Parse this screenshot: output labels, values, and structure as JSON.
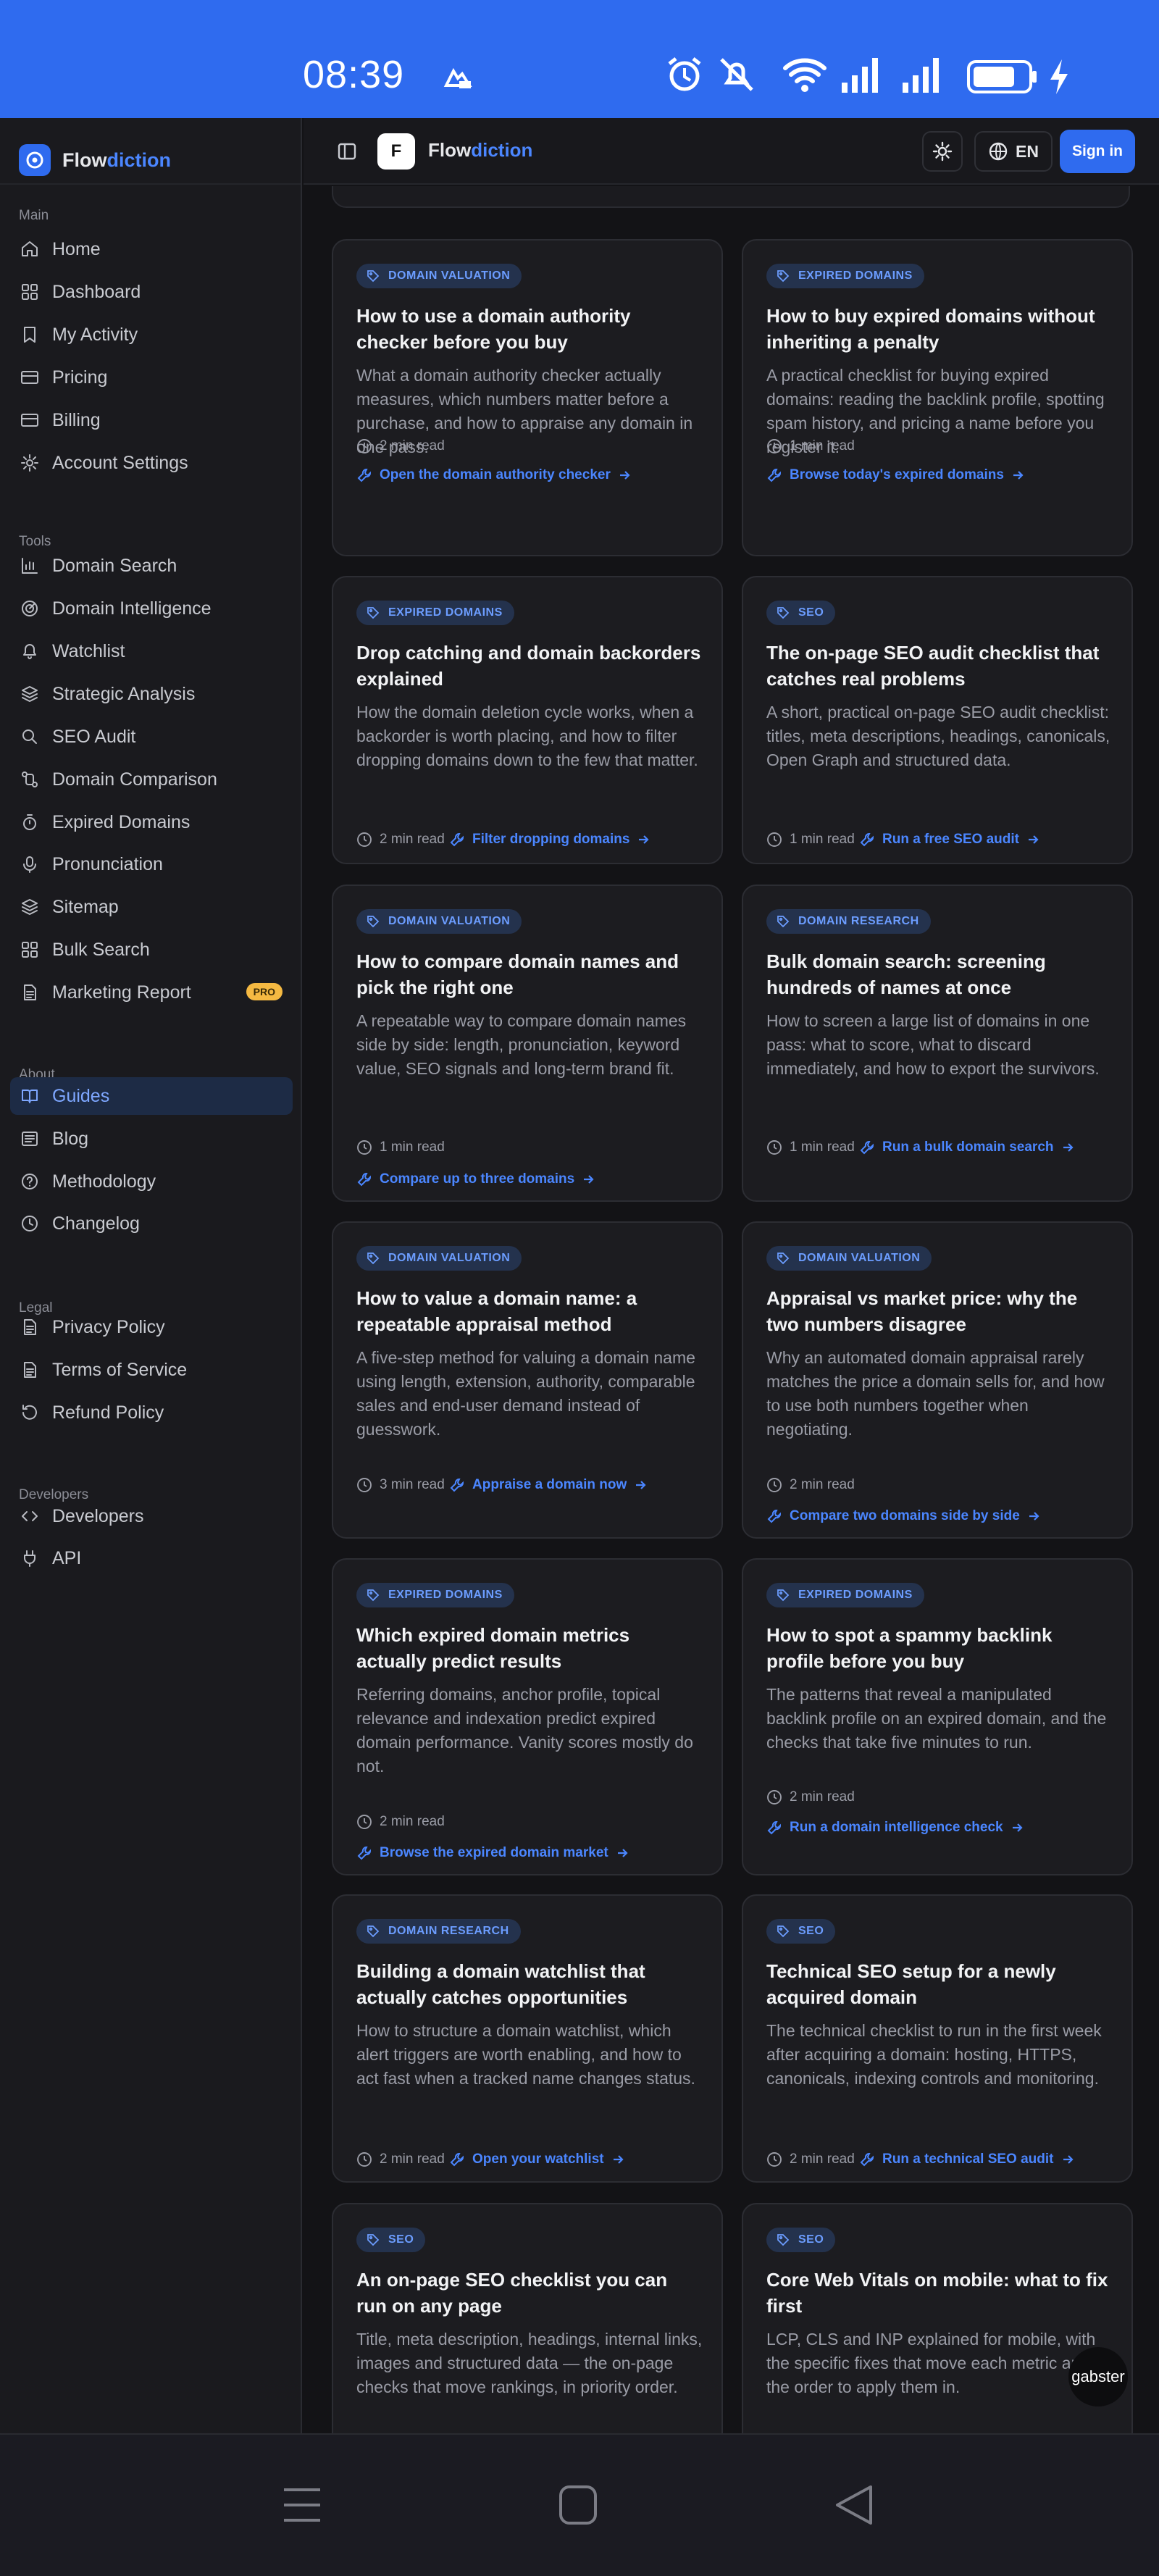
{
  "status_bar": {
    "time": "08:39"
  },
  "brand": {
    "name_part1": "Flow",
    "name_part2": "diction"
  },
  "sidebar": {
    "sections": [
      {
        "title": "Main",
        "items": [
          {
            "label": "Home",
            "icon": "home-icon"
          },
          {
            "label": "Dashboard",
            "icon": "grid-icon"
          },
          {
            "label": "My Activity",
            "icon": "bookmark-icon"
          },
          {
            "label": "Pricing",
            "icon": "card-icon"
          },
          {
            "label": "Billing",
            "icon": "card-icon"
          },
          {
            "label": "Account Settings",
            "icon": "gear-icon"
          }
        ]
      },
      {
        "title": "Tools",
        "items": [
          {
            "label": "Domain Search",
            "icon": "chart-icon"
          },
          {
            "label": "Domain Intelligence",
            "icon": "radar-icon"
          },
          {
            "label": "Watchlist",
            "icon": "bell-icon"
          },
          {
            "label": "Strategic Analysis",
            "icon": "layers-icon"
          },
          {
            "label": "SEO Audit",
            "icon": "search-icon"
          },
          {
            "label": "Domain Comparison",
            "icon": "compare-icon"
          },
          {
            "label": "Expired Domains",
            "icon": "timer-icon"
          },
          {
            "label": "Pronunciation",
            "icon": "mic-icon"
          },
          {
            "label": "Sitemap",
            "icon": "layers-icon"
          },
          {
            "label": "Bulk Search",
            "icon": "grid-icon"
          },
          {
            "label": "Marketing Report",
            "icon": "document-icon",
            "badge": "PRO"
          }
        ]
      },
      {
        "title": "About",
        "items": [
          {
            "label": "Guides",
            "icon": "book-icon",
            "active": true
          },
          {
            "label": "Blog",
            "icon": "newspaper-icon"
          },
          {
            "label": "Methodology",
            "icon": "help-icon"
          },
          {
            "label": "Changelog",
            "icon": "clock-icon"
          }
        ]
      },
      {
        "title": "Legal",
        "items": [
          {
            "label": "Privacy Policy",
            "icon": "document-icon"
          },
          {
            "label": "Terms of Service",
            "icon": "document-icon"
          },
          {
            "label": "Refund Policy",
            "icon": "refund-icon"
          }
        ]
      },
      {
        "title": "Developers",
        "items": [
          {
            "label": "Developers",
            "icon": "code-icon"
          },
          {
            "label": "API",
            "icon": "plug-icon"
          }
        ]
      }
    ]
  },
  "header": {
    "avatar_letter": "F",
    "title_part1": "Flow",
    "title_part2": "diction",
    "lang": "EN",
    "signin": "Sign in"
  },
  "guides": [
    {
      "tag": "DOMAIN VALUATION",
      "title": "How to use a domain authority checker before you buy",
      "desc": "What a domain authority checker actually measures, which numbers matter before a purchase, and how to appraise any domain in one pass.",
      "read": "2 min read",
      "link": "Open the domain authority checker"
    },
    {
      "tag": "EXPIRED DOMAINS",
      "title": "How to buy expired domains without inheriting a penalty",
      "desc": "A practical checklist for buying expired domains: reading the backlink profile, spotting spam history, and pricing a name before you register it.",
      "read": "1 min read",
      "link": "Browse today's expired domains"
    },
    {
      "tag": "EXPIRED DOMAINS",
      "title": "Drop catching and domain backorders explained",
      "desc": "How the domain deletion cycle works, when a backorder is worth placing, and how to filter dropping domains down to the few that matter.",
      "read": "2 min read",
      "link": "Filter dropping domains"
    },
    {
      "tag": "SEO",
      "title": "The on-page SEO audit checklist that catches real problems",
      "desc": "A short, practical on-page SEO audit checklist: titles, meta descriptions, headings, canonicals, Open Graph and structured data.",
      "read": "1 min read",
      "link": "Run a free SEO audit"
    },
    {
      "tag": "DOMAIN VALUATION",
      "title": "How to compare domain names and pick the right one",
      "desc": "A repeatable way to compare domain names side by side: length, pronunciation, keyword value, SEO signals and long-term brand fit.",
      "read": "1 min read",
      "link": "Compare up to three domains"
    },
    {
      "tag": "DOMAIN RESEARCH",
      "title": "Bulk domain search: screening hundreds of names at once",
      "desc": "How to screen a large list of domains in one pass: what to score, what to discard immediately, and how to export the survivors.",
      "read": "1 min read",
      "link": "Run a bulk domain search"
    },
    {
      "tag": "DOMAIN VALUATION",
      "title": "How to value a domain name: a repeatable appraisal method",
      "desc": "A five-step method for valuing a domain name using length, extension, authority, comparable sales and end-user demand instead of guesswork.",
      "read": "3 min read",
      "link": "Appraise a domain now"
    },
    {
      "tag": "DOMAIN VALUATION",
      "title": "Appraisal vs market price: why the two numbers disagree",
      "desc": "Why an automated domain appraisal rarely matches the price a domain sells for, and how to use both numbers together when negotiating.",
      "read": "2 min read",
      "link": "Compare two domains side by side"
    },
    {
      "tag": "EXPIRED DOMAINS",
      "title": "Which expired domain metrics actually predict results",
      "desc": "Referring domains, anchor profile, topical relevance and indexation predict expired domain performance. Vanity scores mostly do not.",
      "read": "2 min read",
      "link": "Browse the expired domain market"
    },
    {
      "tag": "EXPIRED DOMAINS",
      "title": "How to spot a spammy backlink profile before you buy",
      "desc": "The patterns that reveal a manipulated backlink profile on an expired domain, and the checks that take five minutes to run.",
      "read": "2 min read",
      "link": "Run a domain intelligence check"
    },
    {
      "tag": "DOMAIN RESEARCH",
      "title": "Building a domain watchlist that actually catches opportunities",
      "desc": "How to structure a domain watchlist, which alert triggers are worth enabling, and how to act fast when a tracked name changes status.",
      "read": "2 min read",
      "link": "Open your watchlist"
    },
    {
      "tag": "SEO",
      "title": "Technical SEO setup for a newly acquired domain",
      "desc": "The technical checklist to run in the first week after acquiring a domain: hosting, HTTPS, canonicals, indexing controls and monitoring.",
      "read": "2 min read",
      "link": "Run a technical SEO audit"
    },
    {
      "tag": "SEO",
      "title": "An on-page SEO checklist you can run on any page",
      "desc": "Title, meta description, headings, internal links, images and structured data — the on-page checks that move rankings, in priority order.",
      "read": "",
      "link": ""
    },
    {
      "tag": "SEO",
      "title": "Core Web Vitals on mobile: what to fix first",
      "desc": "LCP, CLS and INP explained for mobile, with the specific fixes that move each metric and the order to apply them in.",
      "read": "",
      "link": ""
    }
  ],
  "floating": {
    "gabster": "gabster"
  }
}
